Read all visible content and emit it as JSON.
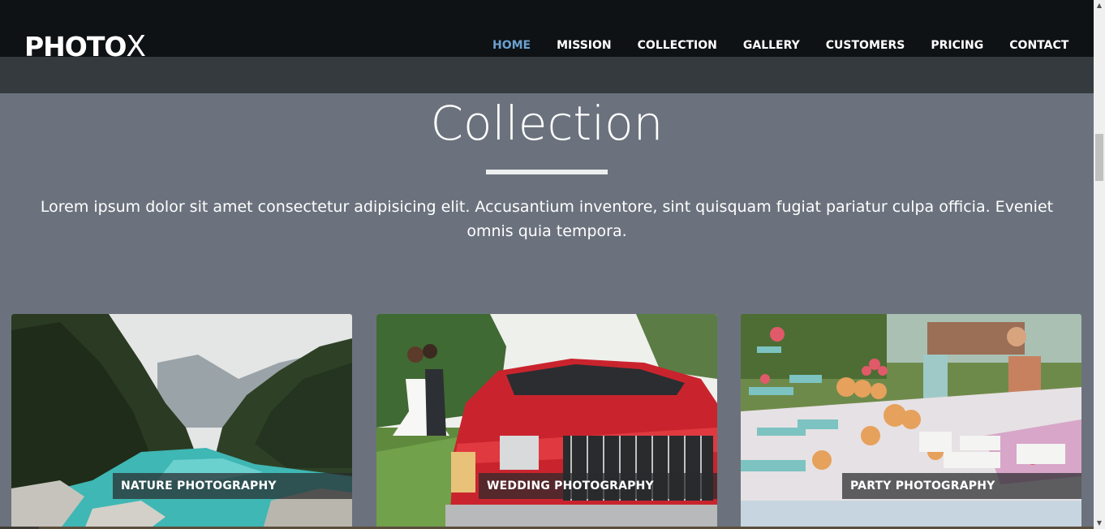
{
  "brand": {
    "logo_main": "PHOTO",
    "logo_accent": "X"
  },
  "nav": {
    "items": [
      {
        "label": "HOME",
        "active": true
      },
      {
        "label": "MISSION"
      },
      {
        "label": "COLLECTION"
      },
      {
        "label": "GALLERY"
      },
      {
        "label": "CUSTOMERS"
      },
      {
        "label": "PRICING"
      },
      {
        "label": "CONTACT"
      }
    ]
  },
  "section": {
    "title": "Collection",
    "description": "Lorem ipsum dolor sit amet consectetur adipisicing elit. Accusantium inventore, sint quisquam fugiat pariatur culpa officia. Eveniet omnis quia tempora."
  },
  "cards": [
    {
      "label": "NATURE PHOTOGRAPHY"
    },
    {
      "label": "WEDDING PHOTOGRAPHY"
    },
    {
      "label": "PARTY PHOTOGRAPHY"
    }
  ],
  "colors": {
    "nav_active": "#6ba0cf",
    "page_bg": "#6b727d",
    "header_bg": "#0e1214"
  }
}
